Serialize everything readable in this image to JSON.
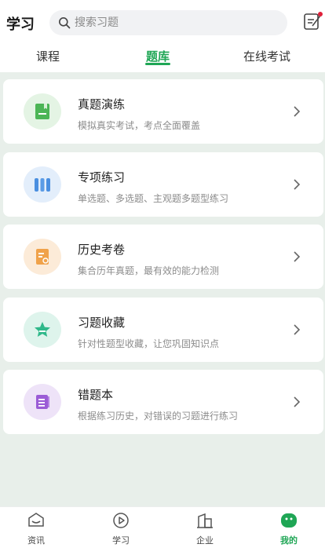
{
  "header": {
    "title": "学习",
    "search_placeholder": "搜索习题",
    "icons": {
      "search": "search-icon",
      "notes": "note-edit-icon"
    },
    "notification_dot_color": "#e0203a"
  },
  "tabs": [
    {
      "label": "课程",
      "active": false
    },
    {
      "label": "题库",
      "active": true
    },
    {
      "label": "在线考试",
      "active": false
    }
  ],
  "accent_color": "#1fa655",
  "cards": [
    {
      "title": "真题演练",
      "subtitle": "模拟真实考试，考点全面覆盖",
      "icon": "book-icon",
      "color": "#4cb556"
    },
    {
      "title": "专项练习",
      "subtitle": "单选题、多选题、主观题多题型练习",
      "icon": "books-icon",
      "color": "#4a8fe0"
    },
    {
      "title": "历史考卷",
      "subtitle": "集合历年真题，最有效的能力检测",
      "icon": "exam-paper-icon",
      "color": "#f0a24a"
    },
    {
      "title": "习题收藏",
      "subtitle": "针对性题型收藏，让您巩固知识点",
      "icon": "star-icon",
      "color": "#2fb88a"
    },
    {
      "title": "错题本",
      "subtitle": "根据练习历史，对错误的习题进行练习",
      "icon": "notebook-icon",
      "color": "#9b5cd6"
    }
  ],
  "bottom_nav": [
    {
      "label": "资讯",
      "icon": "news-icon",
      "active": false
    },
    {
      "label": "学习",
      "icon": "play-circle-icon",
      "active": false
    },
    {
      "label": "企业",
      "icon": "building-icon",
      "active": false
    },
    {
      "label": "我的",
      "icon": "profile-icon",
      "active": true
    }
  ]
}
